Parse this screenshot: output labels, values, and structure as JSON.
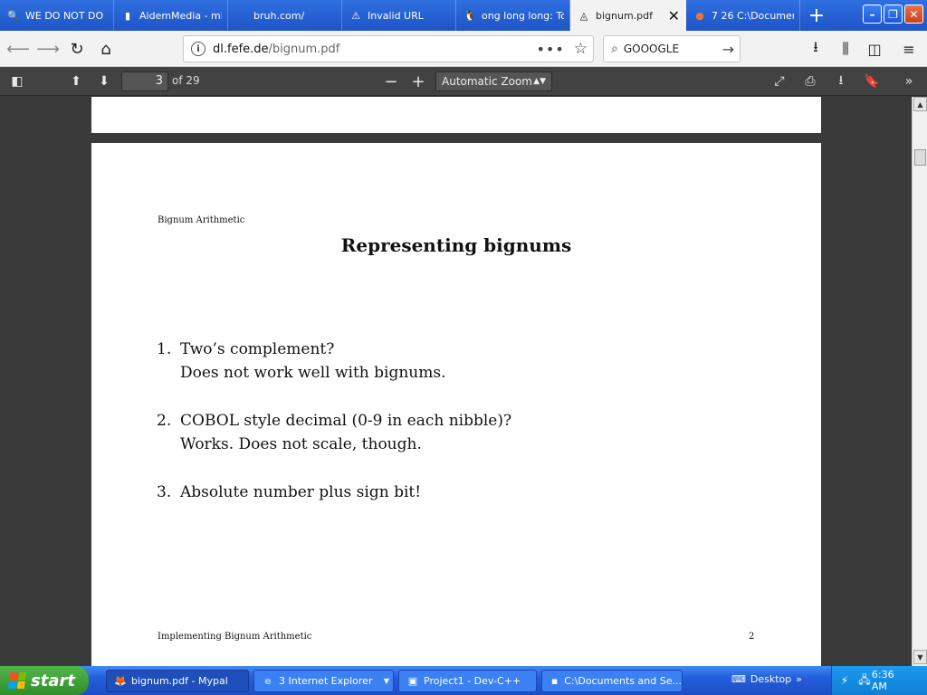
{
  "browser": {
    "tabs": [
      {
        "label": "WE DO NOT DO",
        "icon": "🔍"
      },
      {
        "label": "AidemMedia - mi",
        "icon": "▮"
      },
      {
        "label": "bruh.com/",
        "icon": ""
      },
      {
        "label": "Invalid URL",
        "icon": "⚠"
      },
      {
        "label": "ong long long: To",
        "icon": "🐧"
      },
      {
        "label": "bignum.pdf",
        "icon": "◬",
        "active": true
      },
      {
        "label": "7 26 C:\\Documen",
        "icon": "●"
      }
    ],
    "new_tab": "+",
    "url_host": "dl.fefe.de",
    "url_path": "/bignum.pdf",
    "page_actions": "•••",
    "search_text": "GOOOGLE"
  },
  "pdf_toolbar": {
    "page_number": "3",
    "page_of": "of 29",
    "zoom_label": "Automatic Zoom"
  },
  "document": {
    "header": "Bignum Arithmetic",
    "title": "Representing bignums",
    "items": [
      {
        "num": "1.",
        "line1": "Two’s complement?",
        "line2": "Does not work well with bignums."
      },
      {
        "num": "2.",
        "line1": "COBOL style decimal (0-9 in each nibble)?",
        "line2": "Works. Does not scale, though."
      },
      {
        "num": "3.",
        "line1": "Absolute number plus sign bit!",
        "line2": ""
      }
    ],
    "footer_left": "Implementing Bignum Arithmetic",
    "footer_right": "2"
  },
  "taskbar": {
    "start": "start",
    "tasks": [
      {
        "label": "bignum.pdf - Mypal",
        "icon": "🦊"
      },
      {
        "label": "3 Internet Explorer",
        "icon": "e"
      },
      {
        "label": "Project1 - Dev-C++",
        "icon": "▣"
      },
      {
        "label": "C:\\Documents and Se...",
        "icon": "▪"
      }
    ],
    "desktop": "Desktop",
    "clock": "6:36 AM"
  }
}
